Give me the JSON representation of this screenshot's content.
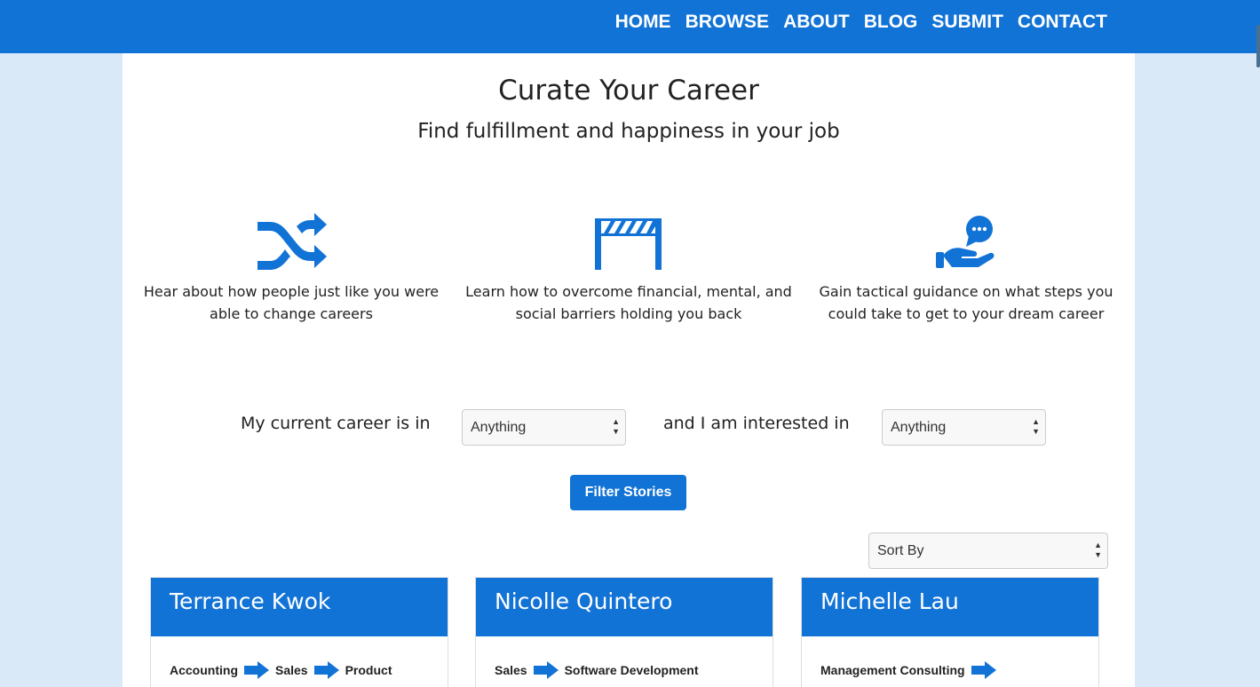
{
  "nav": {
    "items": [
      "HOME",
      "BROWSE",
      "ABOUT",
      "BLOG",
      "SUBMIT",
      "CONTACT"
    ]
  },
  "hero": {
    "title": "Curate Your Career",
    "subtitle": "Find fulfillment and happiness in your job"
  },
  "features": [
    {
      "icon": "shuffle-icon",
      "text": "Hear about how people just like you were able to change careers"
    },
    {
      "icon": "barrier-icon",
      "text": "Learn how to overcome financial, mental, and social barriers holding you back"
    },
    {
      "icon": "hand-chat-icon",
      "text": "Gain tactical guidance on what steps you could take to get to your dream career"
    }
  ],
  "filter": {
    "current_label": "My current career is in",
    "current_value": "Anything",
    "interested_label": "and I am interested in",
    "interested_value": "Anything",
    "button_label": "Filter Stories"
  },
  "sort": {
    "value": "Sort By"
  },
  "stories": [
    {
      "name": "Terrance Kwok",
      "path": [
        "Accounting",
        "Sales",
        "Product"
      ]
    },
    {
      "name": "Nicolle Quintero",
      "path": [
        "Sales",
        "Software Development"
      ]
    },
    {
      "name": "Michelle Lau",
      "path": [
        "Management Consulting"
      ]
    }
  ],
  "colors": {
    "brand": "#1273d6",
    "page_bg": "#d9e9f8"
  }
}
